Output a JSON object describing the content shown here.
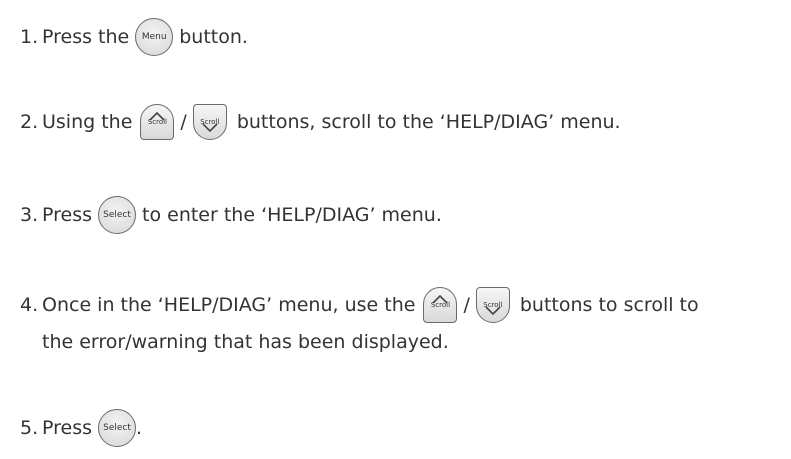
{
  "steps": [
    {
      "num": "1.",
      "a": "Press the",
      "btn": "Menu",
      "b": "button."
    },
    {
      "num": "2.",
      "a": "Using the",
      "sep": "/",
      "b": "buttons, scroll to the ‘HELP/DIAG’ menu."
    },
    {
      "num": "3.",
      "a": "Press",
      "btn": "Select",
      "b": "to enter the ‘HELP/DIAG’ menu."
    },
    {
      "num": "4.",
      "a": "Once in the ‘HELP/DIAG’ menu, use the",
      "sep": "/",
      "b": "buttons to scroll to",
      "c": "the error/warning that has been displayed."
    },
    {
      "num": "5.",
      "a": "Press",
      "btn": "Select",
      "b": "."
    }
  ],
  "scroll_label": "Scroll"
}
